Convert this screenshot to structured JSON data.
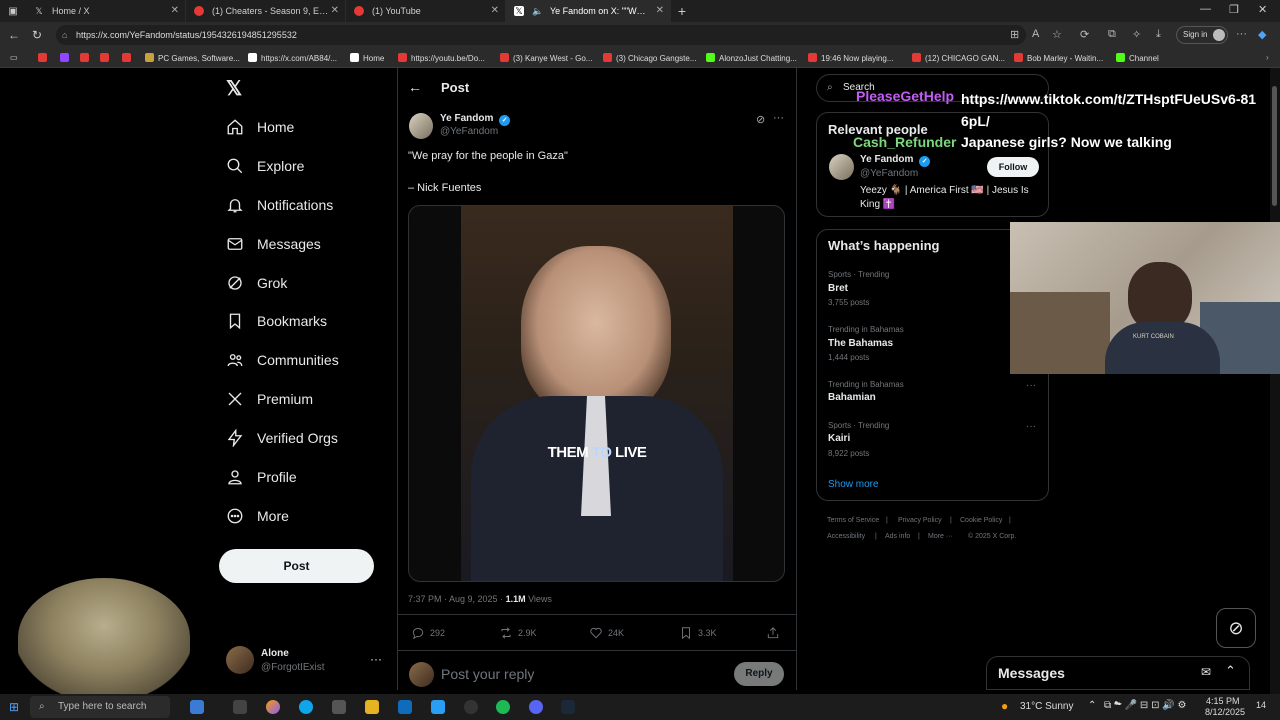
{
  "browser": {
    "tabs": [
      {
        "label": "Home / X",
        "icon": "x-logo-icon",
        "active": false
      },
      {
        "label": "(1) Cheaters - Season 9, Episode",
        "icon": "youtube-icon",
        "active": false
      },
      {
        "label": "(1) YouTube",
        "icon": "youtube-icon",
        "active": false
      },
      {
        "label": "Ye Fandom on X: \"\"We pray f",
        "icon": "x-logo-icon",
        "active": true
      }
    ],
    "url": "https://x.com/YeFandom/status/1954326194851295532",
    "sign_in": "Sign in",
    "bookmarks": [
      "PC Games, Software...",
      "https://x.com/AB84/...",
      "Home",
      "https://youtu.be/Do...",
      "(3) Kanye West - Go...",
      "(3) Chicago Gangste...",
      "AlonzoJust Chatting...",
      "19:46 Now playing...",
      "(12) CHICAGO GAN...",
      "Bob Marley - Waitin...",
      "Channel"
    ]
  },
  "sidebar": {
    "items": [
      {
        "label": "Home",
        "icon": "home-icon"
      },
      {
        "label": "Explore",
        "icon": "search-icon"
      },
      {
        "label": "Notifications",
        "icon": "bell-icon"
      },
      {
        "label": "Messages",
        "icon": "mail-icon"
      },
      {
        "label": "Grok",
        "icon": "grok-icon"
      },
      {
        "label": "Bookmarks",
        "icon": "bookmark-icon"
      },
      {
        "label": "Communities",
        "icon": "communities-icon"
      },
      {
        "label": "Premium",
        "icon": "x-logo-icon"
      },
      {
        "label": "Verified Orgs",
        "icon": "lightning-icon"
      },
      {
        "label": "Profile",
        "icon": "person-icon"
      },
      {
        "label": "More",
        "icon": "more-circle-icon"
      }
    ],
    "post_button": "Post",
    "account": {
      "name": "Alone",
      "handle": "@ForgotIExist"
    }
  },
  "post": {
    "header": "Post",
    "author_name": "Ye Fandom",
    "author_handle": "@YeFandom",
    "text_line1": "\"We pray for the people in Gaza\"",
    "text_line2": "– Nick Fuentes",
    "caption": "THEM TO LIVE",
    "caption_highlight": "TO",
    "timestamp": "7:37 PM · Aug 9, 2025 · ",
    "views_count": "1.1M",
    "views_label": " Views",
    "stats": {
      "replies": "292",
      "reposts": "2.9K",
      "likes": "24K",
      "bookmarks": "3.3K"
    },
    "reply_placeholder": "Post your reply",
    "reply_button": "Reply"
  },
  "right": {
    "search_placeholder": "Search",
    "relevant_title": "Relevant people",
    "person": {
      "name": "Ye Fandom",
      "handle": "@YeFandom",
      "bio": "Yeezy 🐐 | America First 🇺🇸 | Jesus Is King ✝️",
      "follow": "Follow"
    },
    "happening_title": "What’s happening",
    "trends": [
      {
        "category": "Sports · Trending",
        "name": "Bret",
        "count": "3,755 posts"
      },
      {
        "category": "Trending in Bahamas",
        "name": "The Bahamas",
        "count": "1,444 posts"
      },
      {
        "category": "Trending in Bahamas",
        "name": "Bahamian",
        "count": ""
      },
      {
        "category": "Sports · Trending",
        "name": "Kairi",
        "count": "8,922 posts"
      }
    ],
    "show_more": "Show more",
    "footer": [
      "Terms of Service",
      "Privacy Policy",
      "Cookie Policy",
      "Accessibility",
      "Ads info",
      "More ···",
      "© 2025 X Corp."
    ],
    "messages": "Messages"
  },
  "overlay": {
    "chat": [
      {
        "user": "PleaseGetHelp",
        "color": "#c45cf5",
        "message": "https://www.tiktok.com/t/ZTHsptFUeUSv6-816pL/"
      },
      {
        "user": "Cash_Refunder",
        "color": "#7dd87d",
        "message": "Japanese girls? Now we talking"
      }
    ],
    "webcam_shirt": "KURT COBAIN"
  },
  "taskbar": {
    "search_placeholder": "Type here to search",
    "weather": "31°C  Sunny",
    "time": "4:15 PM",
    "date": "8/12/2025",
    "notif": "14"
  },
  "colors": {
    "accent": "#1d9bf0",
    "bg": "#000000",
    "muted": "#71767b",
    "border": "#2f3336"
  }
}
